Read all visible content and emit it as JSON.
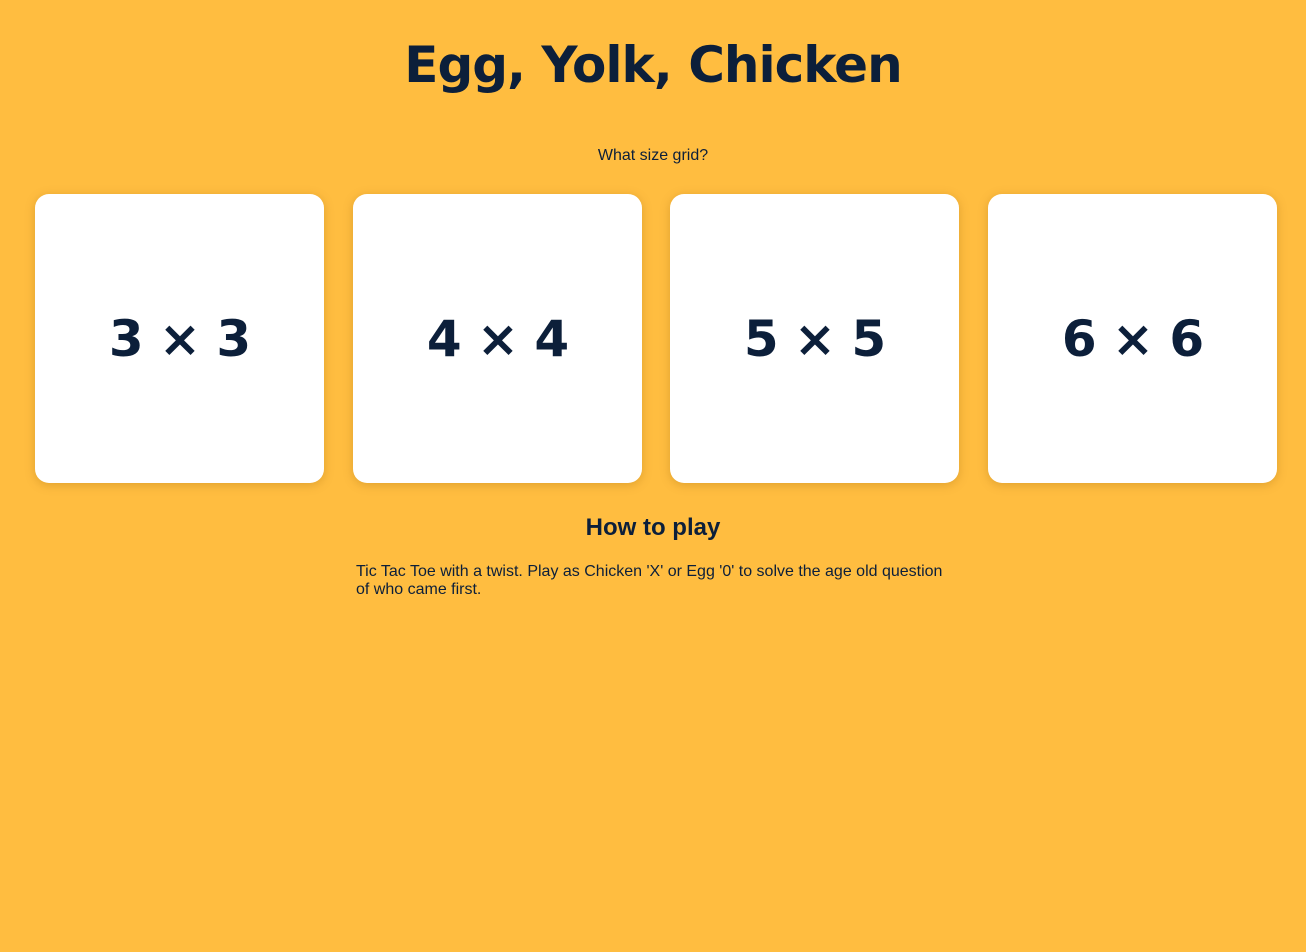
{
  "page": {
    "title": "Egg, Yolk, Chicken",
    "background_color": "#FFBD40",
    "text_color": "#0C1F3A"
  },
  "grid_select": {
    "prompt": "What size grid?",
    "options": [
      {
        "label": "3 × 3"
      },
      {
        "label": "4 × 4"
      },
      {
        "label": "5 × 5"
      },
      {
        "label": "6 × 6"
      }
    ]
  },
  "how_to_play": {
    "heading": "How to play",
    "text": "Tic Tac Toe with a twist. Play as Chicken 'X' or Egg '0' to solve the age old question of who came first."
  }
}
